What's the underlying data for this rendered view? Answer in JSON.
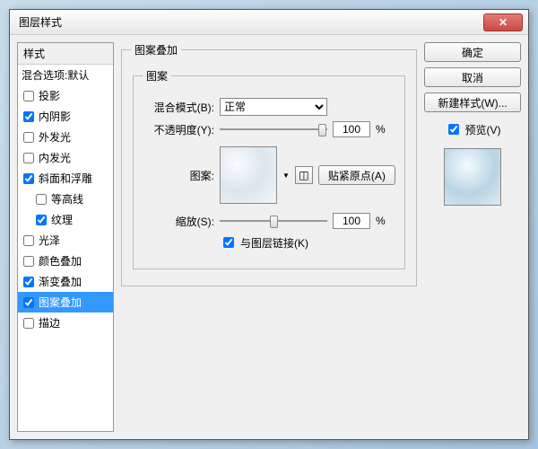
{
  "title": "图层样式",
  "styles": {
    "header": "样式",
    "blend": "混合选项:默认",
    "items": [
      {
        "label": "投影",
        "checked": false
      },
      {
        "label": "内阴影",
        "checked": true
      },
      {
        "label": "外发光",
        "checked": false
      },
      {
        "label": "内发光",
        "checked": false
      },
      {
        "label": "斜面和浮雕",
        "checked": true
      },
      {
        "label": "等高线",
        "checked": false,
        "indent": true
      },
      {
        "label": "纹理",
        "checked": true,
        "indent": true
      },
      {
        "label": "光泽",
        "checked": false
      },
      {
        "label": "颜色叠加",
        "checked": false
      },
      {
        "label": "渐变叠加",
        "checked": true
      },
      {
        "label": "图案叠加",
        "checked": true,
        "selected": true
      },
      {
        "label": "描边",
        "checked": false
      }
    ]
  },
  "panel": {
    "groupTitle": "图案叠加",
    "subGroup": "图案",
    "blendLabel": "混合模式(B):",
    "blendValue": "正常",
    "opacityLabel": "不透明度(Y):",
    "opacityValue": "100",
    "pct": "%",
    "patternLabel": "图案:",
    "snapBtn": "贴紧原点(A)",
    "scaleLabel": "缩放(S):",
    "scaleValue": "100",
    "linkLabel": "与图层链接(K)"
  },
  "right": {
    "ok": "确定",
    "cancel": "取消",
    "newStyle": "新建样式(W)...",
    "preview": "预览(V)"
  }
}
